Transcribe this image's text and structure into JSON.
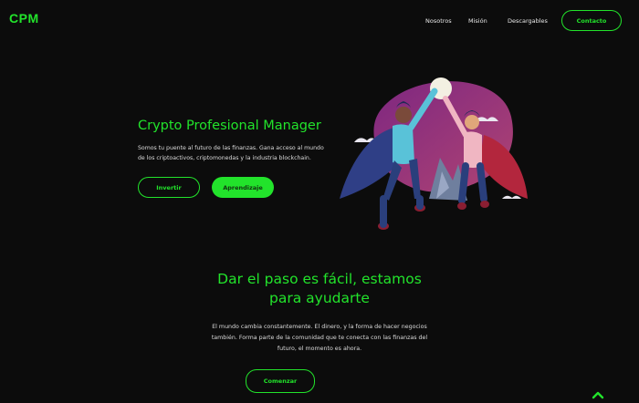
{
  "header": {
    "logo": "CPM",
    "nav": [
      "Nosotros",
      "Misión",
      "Descargables"
    ],
    "contact_label": "Contacto"
  },
  "hero": {
    "title": "Crypto Profesional Manager",
    "description": "Somos tu puente al futuro de las finanzas. Gana acceso al mundo de los criptoactivos, criptomonedas y la industria blockchain.",
    "invest_label": "Invertir",
    "learn_label": "Aprendizaje"
  },
  "section": {
    "title_line1": "Dar el paso es fácil, estamos",
    "title_line2": "para ayudarte",
    "description": "El mundo cambia constantemente. El dinero, y la forma de hacer negocios también. Forma parte de la comunidad que te conecta con las finanzas del futuro, el momento es ahora.",
    "start_label": "Comenzar"
  },
  "colors": {
    "accent": "#22e32b",
    "background": "#0c0c0c"
  },
  "icons": {
    "scroll_top": "chevron-up-icon"
  }
}
